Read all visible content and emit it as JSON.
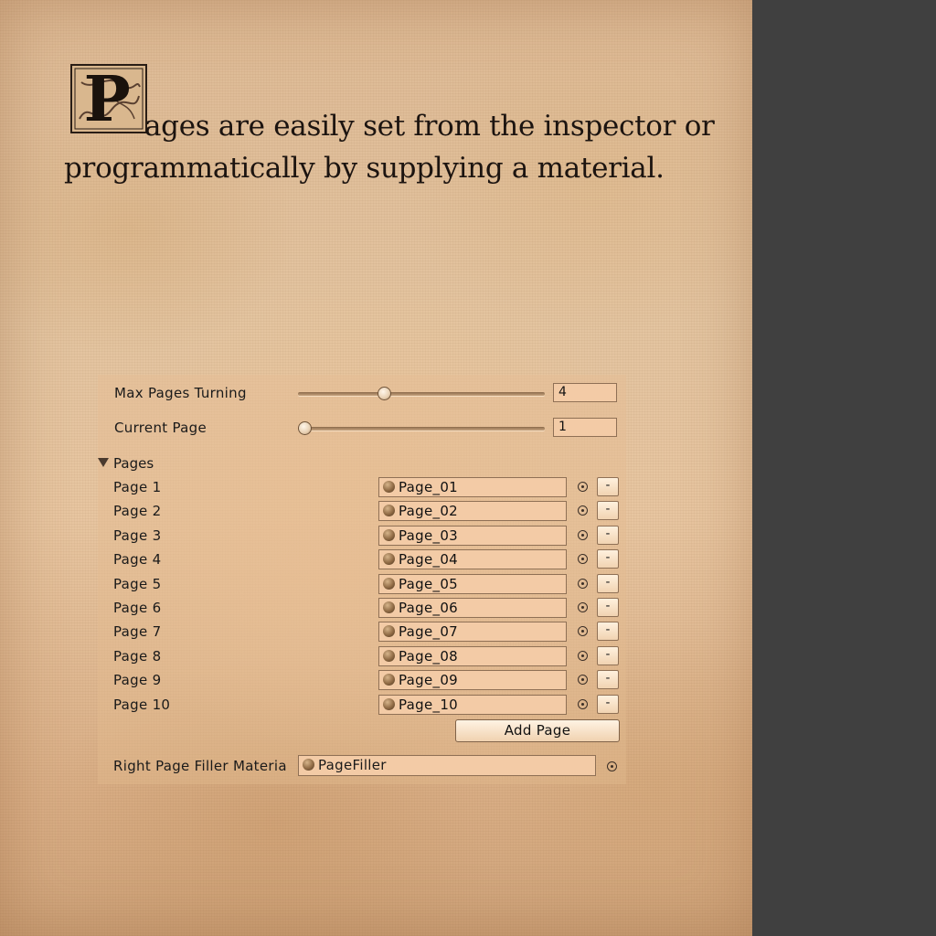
{
  "intro": {
    "dropcap_letter": "P",
    "line1": "ages are easily set from the inspector or",
    "line2": "programmatically by supplying a material."
  },
  "inspector": {
    "max_pages_turning": {
      "label": "Max Pages Turning",
      "value": "4",
      "slider_fraction": 0.34
    },
    "current_page": {
      "label": "Current Page",
      "value": "1",
      "slider_fraction": 0.0
    },
    "pages_foldout_label": "Pages",
    "pages": [
      {
        "label": "Page 1",
        "material": "Page_01"
      },
      {
        "label": "Page 2",
        "material": "Page_02"
      },
      {
        "label": "Page 3",
        "material": "Page_03"
      },
      {
        "label": "Page 4",
        "material": "Page_04"
      },
      {
        "label": "Page 5",
        "material": "Page_05"
      },
      {
        "label": "Page 6",
        "material": "Page_06"
      },
      {
        "label": "Page 7",
        "material": "Page_07"
      },
      {
        "label": "Page 8",
        "material": "Page_08"
      },
      {
        "label": "Page 9",
        "material": "Page_09"
      },
      {
        "label": "Page 10",
        "material": "Page_10"
      }
    ],
    "remove_label": "-",
    "add_page_label": "Add Page",
    "right_filler": {
      "label": "Right Page Filler Materia",
      "material": "PageFiller"
    }
  },
  "colors": {
    "field_bg": "#f3cba6",
    "panel_dark": "#404040",
    "text": "#1a1a1a"
  },
  "icons": {
    "material": "material-sphere-icon",
    "object_picker": "object-picker-icon",
    "foldout": "foldout-triangle-icon"
  }
}
